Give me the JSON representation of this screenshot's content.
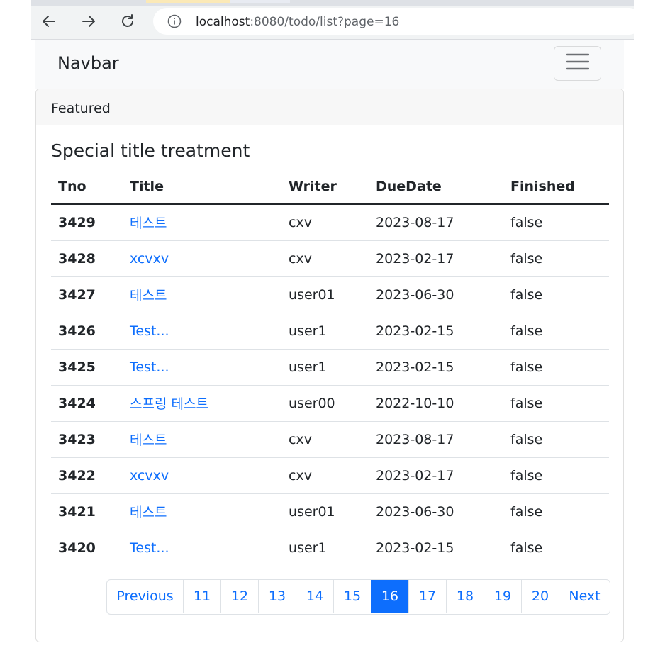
{
  "browser": {
    "url_host": "localhost",
    "url_rest": ":8080/todo/list?page=16",
    "icons": [
      "back-arrow-icon",
      "forward-arrow-icon",
      "reload-icon",
      "info-icon"
    ]
  },
  "navbar": {
    "brand": "Navbar",
    "toggler_icon": "hamburger-icon"
  },
  "card": {
    "header": "Featured",
    "title": "Special title treatment"
  },
  "table": {
    "columns": [
      "Tno",
      "Title",
      "Writer",
      "DueDate",
      "Finished"
    ],
    "rows": [
      {
        "tno": "3429",
        "title": "테스트",
        "writer": "cxv",
        "due": "2023-08-17",
        "finished": "false"
      },
      {
        "tno": "3428",
        "title": "xcvxv",
        "writer": "cxv",
        "due": "2023-02-17",
        "finished": "false"
      },
      {
        "tno": "3427",
        "title": "테스트",
        "writer": "user01",
        "due": "2023-06-30",
        "finished": "false"
      },
      {
        "tno": "3426",
        "title": "Test...",
        "writer": "user1",
        "due": "2023-02-15",
        "finished": "false"
      },
      {
        "tno": "3425",
        "title": "Test...",
        "writer": "user1",
        "due": "2023-02-15",
        "finished": "false"
      },
      {
        "tno": "3424",
        "title": "스프링 테스트",
        "writer": "user00",
        "due": "2022-10-10",
        "finished": "false"
      },
      {
        "tno": "3423",
        "title": "테스트",
        "writer": "cxv",
        "due": "2023-08-17",
        "finished": "false"
      },
      {
        "tno": "3422",
        "title": "xcvxv",
        "writer": "cxv",
        "due": "2023-02-17",
        "finished": "false"
      },
      {
        "tno": "3421",
        "title": "테스트",
        "writer": "user01",
        "due": "2023-06-30",
        "finished": "false"
      },
      {
        "tno": "3420",
        "title": "Test...",
        "writer": "user1",
        "due": "2023-02-15",
        "finished": "false"
      }
    ]
  },
  "pagination": {
    "previous": "Previous",
    "pages": [
      "11",
      "12",
      "13",
      "14",
      "15",
      "16",
      "17",
      "18",
      "19",
      "20"
    ],
    "current": "16",
    "next": "Next"
  },
  "colors": {
    "link": "#0d6efd",
    "active_page_bg": "#0d6efd",
    "navbar_bg": "#f8f9fa",
    "card_header_bg": "#f7f7f7"
  }
}
